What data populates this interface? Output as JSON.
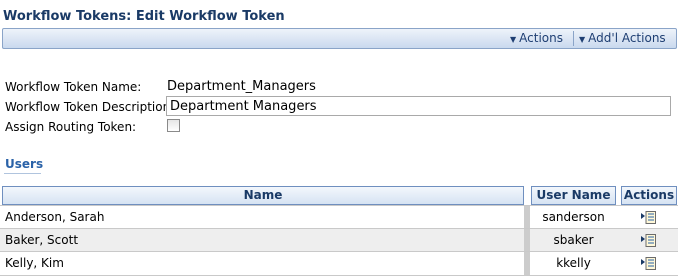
{
  "header": {
    "title": "Workflow Tokens: Edit Workflow Token"
  },
  "toolbar": {
    "actions_label": "Actions",
    "addl_actions_label": "Add'l Actions"
  },
  "form": {
    "name_label": "Workflow Token Name:",
    "name_value": "Department_Managers",
    "description_label": "Workflow Token Description:",
    "description_value": "Department Managers",
    "routing_label": "Assign Routing Token:",
    "routing_checked": false
  },
  "users": {
    "section_title": "Users",
    "columns": {
      "name": "Name",
      "user_name": "User Name",
      "actions": "Actions"
    },
    "rows": [
      {
        "name": "Anderson, Sarah",
        "user_name": "sanderson"
      },
      {
        "name": "Baker, Scott",
        "user_name": "sbaker"
      },
      {
        "name": "Kelly, Kim",
        "user_name": "kkelly"
      }
    ]
  },
  "colors": {
    "title": "#1a3a66",
    "accent": "#2a62a8",
    "toolbar_border": "#8aa4c8",
    "row_alt": "#eeeeee"
  }
}
